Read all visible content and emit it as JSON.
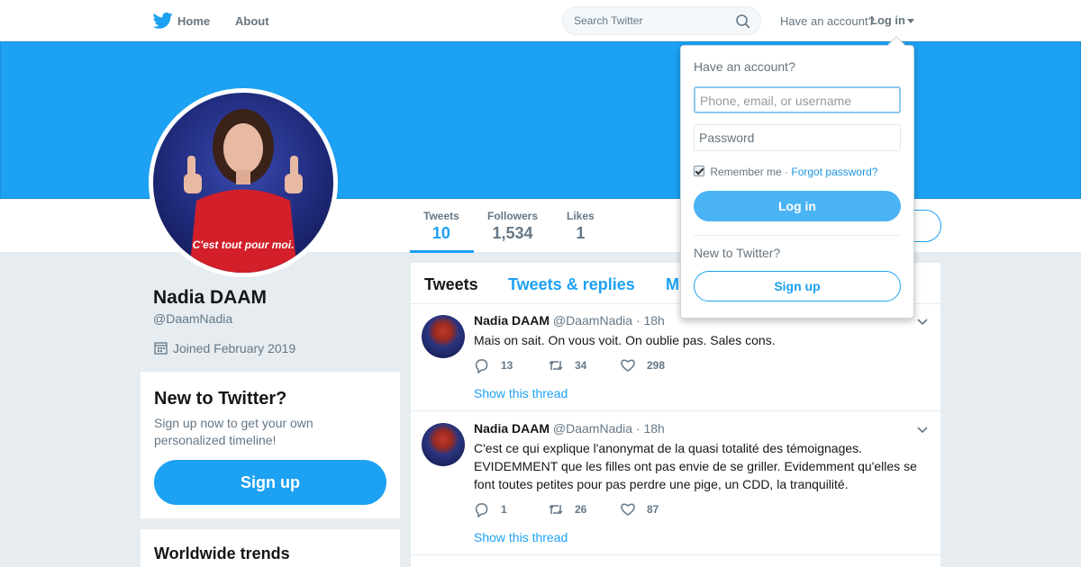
{
  "nav": {
    "home": "Home",
    "about": "About",
    "search_placeholder": "Search Twitter",
    "have_account": "Have an account?",
    "login": "Log in"
  },
  "profile": {
    "name": "Nadia DAAM",
    "handle": "@DaamNadia",
    "joined": "Joined February 2019",
    "avatar_caption": "C'est tout pour moi.",
    "stats": [
      {
        "label": "Tweets",
        "value": "10"
      },
      {
        "label": "Followers",
        "value": "1,534"
      },
      {
        "label": "Likes",
        "value": "1"
      }
    ]
  },
  "new_to_twitter": {
    "title": "New to Twitter?",
    "text": "Sign up now to get your own personalized timeline!",
    "button": "Sign up"
  },
  "trends": {
    "title": "Worldwide trends"
  },
  "timeline": {
    "tabs": [
      "Tweets",
      "Tweets & replies",
      "M"
    ],
    "tweets": [
      {
        "name": "Nadia DAAM",
        "handle": "@DaamNadia",
        "time": "· 18h",
        "text": "Mais on sait. On vous voit. On oublie pas. Sales cons.",
        "replies": "13",
        "retweets": "34",
        "likes": "298",
        "thread": "Show this thread"
      },
      {
        "name": "Nadia DAAM",
        "handle": "@DaamNadia",
        "time": "· 18h",
        "text": "C'est ce qui explique l'anonymat de la quasi totalité des témoignages. EVIDEMMENT que les filles ont pas envie de se griller. Evidemment qu'elles se font toutes petites pour pas perdre une pige, un CDD, la tranquilité.",
        "replies": "1",
        "retweets": "26",
        "likes": "87",
        "thread": "Show this thread"
      }
    ]
  },
  "login_dropdown": {
    "title": "Have an account?",
    "username_placeholder": "Phone, email, or username",
    "password_placeholder": "Password",
    "remember": "Remember me",
    "separator": " · ",
    "forgot": "Forgot password?",
    "login_button": "Log in",
    "new": "New to Twitter?",
    "signup_button": "Sign up"
  },
  "colors": {
    "brand": "#1da1f2",
    "background": "#e6ecf0"
  }
}
